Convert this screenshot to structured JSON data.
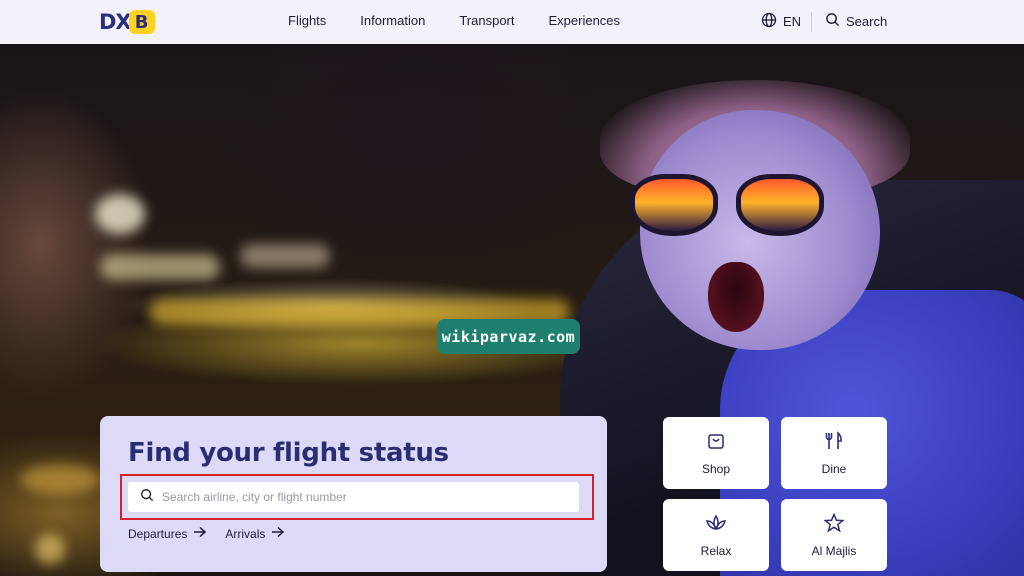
{
  "brand": {
    "logo_text": "DXB"
  },
  "nav": {
    "links": [
      "Flights",
      "Information",
      "Transport",
      "Experiences"
    ],
    "language": "EN",
    "search_label": "Search"
  },
  "watermark": "wikiparvaz.com",
  "flight_status": {
    "title": "Find your flight status",
    "search_placeholder": "Search airline, city or flight number",
    "search_value": "",
    "departures_label": "Departures",
    "arrivals_label": "Arrivals"
  },
  "tiles": [
    {
      "label": "Shop",
      "icon": "shopping-bag-icon"
    },
    {
      "label": "Dine",
      "icon": "fork-knife-icon"
    },
    {
      "label": "Relax",
      "icon": "lotus-icon"
    },
    {
      "label": "Al Majlis",
      "icon": "star-icon"
    }
  ],
  "colors": {
    "nav_bg": "#f3f2fb",
    "brand_navy": "#2b2f7e",
    "brand_yellow": "#ffd21f",
    "card_bg": "#dcdaf6",
    "highlight_red": "#d6242e"
  }
}
